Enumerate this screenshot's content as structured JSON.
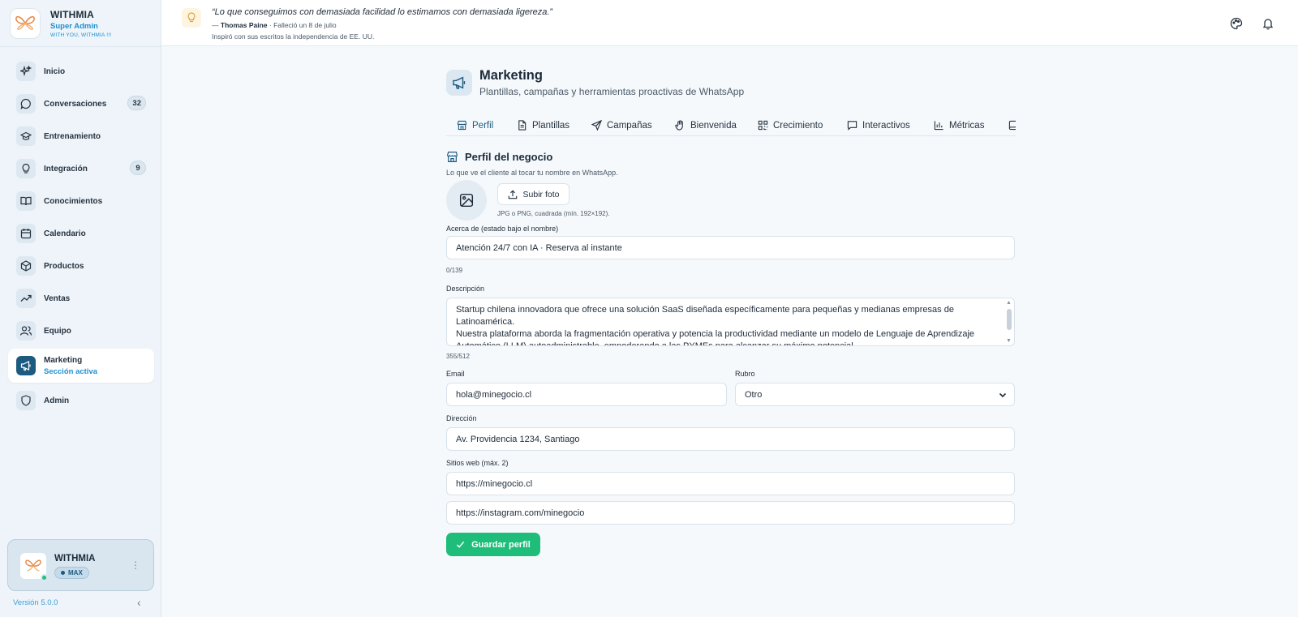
{
  "brand": {
    "name": "WITHMIA",
    "role": "Super Admin",
    "slogan": "WITH YOU, WITHMIA !!!"
  },
  "nav": [
    {
      "label": "Inicio",
      "icon": "sparkles-icon",
      "badge": ""
    },
    {
      "label": "Conversaciones",
      "icon": "chat-bubble-icon",
      "badge": "32"
    },
    {
      "label": "Entrenamiento",
      "icon": "graduation-cap-icon",
      "badge": ""
    },
    {
      "label": "Integración",
      "icon": "lightbulb-icon",
      "badge": "9"
    },
    {
      "label": "Conocimientos",
      "icon": "book-open-icon",
      "badge": ""
    },
    {
      "label": "Calendario",
      "icon": "calendar-icon",
      "badge": ""
    },
    {
      "label": "Productos",
      "icon": "box-icon",
      "badge": ""
    },
    {
      "label": "Ventas",
      "icon": "trending-up-icon",
      "badge": ""
    },
    {
      "label": "Equipo",
      "icon": "users-icon",
      "badge": ""
    },
    {
      "label": "Marketing",
      "icon": "megaphone-icon",
      "sub": "Sección activa",
      "active": true
    },
    {
      "label": "Admin",
      "icon": "shield-icon",
      "badge": ""
    }
  ],
  "account": {
    "name": "WITHMIA",
    "plan": "MAX",
    "status_color": "#22c07a"
  },
  "version": "Versión 5.0.0",
  "quote": {
    "text": "“Lo que conseguimos con demasiada facilidad lo estimamos con demasiada ligereza.”",
    "author": "Thomas Paine",
    "meta_prefix": "— ",
    "meta_suffix": " · Falleció un 8 de julio",
    "bio": "Inspiró con sus escritos la independencia de EE. UU."
  },
  "page": {
    "title": "Marketing",
    "subtitle": "Plantillas, campañas y herramientas proactivas de WhatsApp"
  },
  "tabs": [
    {
      "label": "Perfil",
      "icon": "store-icon",
      "active": true
    },
    {
      "label": "Plantillas",
      "icon": "file-text-icon"
    },
    {
      "label": "Campañas",
      "icon": "send-icon"
    },
    {
      "label": "Bienvenida",
      "icon": "hand-wave-icon"
    },
    {
      "label": "Crecimiento",
      "icon": "qr-code-icon"
    },
    {
      "label": "Interactivos",
      "icon": "message-square-icon"
    },
    {
      "label": "Métricas",
      "icon": "bar-chart-icon"
    }
  ],
  "profile": {
    "section_title": "Perfil del negocio",
    "section_subtitle": "Lo que ve el cliente al tocar tu nombre en WhatsApp.",
    "upload_label": "Subir foto",
    "upload_hint": "JPG o PNG, cuadrada (mín. 192×192).",
    "about_label": "Acerca de (estado bajo el nombre)",
    "about_value": "Atención 24/7 con IA · Reserva al instante",
    "about_counter": "0/139",
    "description_label": "Descripción",
    "description_line1": "Startup chilena innovadora que ofrece una solución SaaS diseñada específicamente para pequeñas y medianas empresas de Latinoamérica.",
    "description_line2": "Nuestra plataforma aborda la fragmentación operativa y potencia la productividad mediante un modelo de Lenguaje de Aprendizaje Automático (LLM) autoadministrable, empoderando a las PYMEs para alcanzar su máximo potencial.",
    "description_counter": "355/512",
    "email_label": "Email",
    "email_value": "hola@minegocio.cl",
    "category_label": "Rubro",
    "category_value": "Otro",
    "address_label": "Dirección",
    "address_value": "Av. Providencia 1234, Santiago",
    "websites_label": "Sitios web (máx. 2)",
    "website1": "https://minegocio.cl",
    "website2": "https://instagram.com/minegocio",
    "save_label": "Guardar perfil"
  },
  "colors": {
    "accent": "#1c5a80",
    "link": "#1d8fd0",
    "save": "#1fbd7a"
  }
}
